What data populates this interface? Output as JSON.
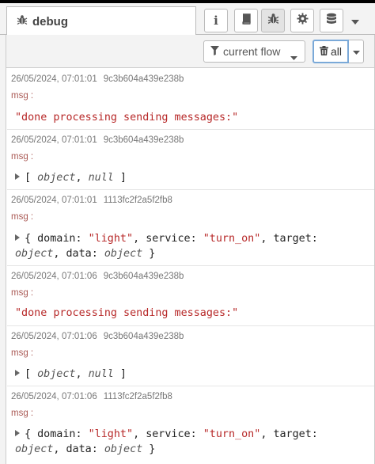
{
  "tab": {
    "title": "debug",
    "icon": "bug-icon"
  },
  "sidebar_buttons": [
    {
      "icon": "info-icon",
      "glyph": "i",
      "active": false
    },
    {
      "icon": "book-icon",
      "active": false
    },
    {
      "icon": "bug-icon",
      "active": true
    },
    {
      "icon": "gear-icon",
      "active": false
    },
    {
      "icon": "database-icon",
      "active": false
    },
    {
      "icon": "chevron-down-icon",
      "active": false
    }
  ],
  "toolbar": {
    "filter_label": "current flow",
    "clear_label": "all"
  },
  "messages": [
    {
      "timestamp": "26/05/2024, 07:01:01",
      "node_id": "9c3b604a439e238b",
      "label": "msg :",
      "kind": "string",
      "value": "\"done processing sending messages:\""
    },
    {
      "timestamp": "26/05/2024, 07:01:01",
      "node_id": "9c3b604a439e238b",
      "label": "msg :",
      "kind": "array",
      "open": "[ ",
      "item1": "object",
      "sep": ", ",
      "item2": "null",
      "close": " ]"
    },
    {
      "timestamp": "26/05/2024, 07:01:01",
      "node_id": "1113fc2f2a5f2fb8",
      "label": "msg :",
      "kind": "object",
      "domain": "\"light\"",
      "service": "\"turn_on\"",
      "target": "object",
      "data": "object"
    },
    {
      "timestamp": "26/05/2024, 07:01:06",
      "node_id": "9c3b604a439e238b",
      "label": "msg :",
      "kind": "string",
      "value": "\"done processing sending messages:\""
    },
    {
      "timestamp": "26/05/2024, 07:01:06",
      "node_id": "9c3b604a439e238b",
      "label": "msg :",
      "kind": "array",
      "open": "[ ",
      "item1": "object",
      "sep": ", ",
      "item2": "null",
      "close": " ]"
    },
    {
      "timestamp": "26/05/2024, 07:01:06",
      "node_id": "1113fc2f2a5f2fb8",
      "label": "msg :",
      "kind": "object",
      "domain": "\"light\"",
      "service": "\"turn_on\"",
      "target": "object",
      "data": "object"
    }
  ],
  "object_keys": {
    "domain": "domain: ",
    "service": "service: ",
    "target": "target:",
    "data": "data: "
  }
}
